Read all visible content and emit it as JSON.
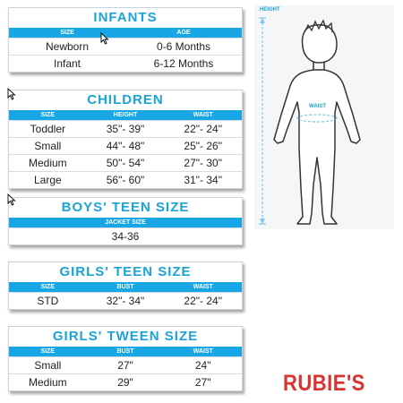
{
  "infants": {
    "title": "INFANTS",
    "headers": [
      "SIZE",
      "AGE"
    ],
    "rows": [
      [
        "Newborn",
        "0-6 Months"
      ],
      [
        "Infant",
        "6-12 Months"
      ]
    ]
  },
  "children": {
    "title": "CHILDREN",
    "headers": [
      "SIZE",
      "HEIGHT",
      "WAIST"
    ],
    "rows": [
      [
        "Toddler",
        "35\"- 39\"",
        "22\"- 24\""
      ],
      [
        "Small",
        "44\"- 48\"",
        "25\"- 26\""
      ],
      [
        "Medium",
        "50\"- 54\"",
        "27\"- 30\""
      ],
      [
        "Large",
        "56\"- 60\"",
        "31\"- 34\""
      ]
    ]
  },
  "boys_teen": {
    "title": "BOYS' TEEN SIZE",
    "headers": [
      "JACKET SIZE"
    ],
    "rows": [
      [
        "34-36"
      ]
    ]
  },
  "girls_teen": {
    "title": "GIRLS' TEEN SIZE",
    "headers": [
      "SIZE",
      "BUST",
      "WAIST"
    ],
    "rows": [
      [
        "STD",
        "32\"- 34\"",
        "22\"- 24\""
      ]
    ]
  },
  "girls_tween": {
    "title": "GIRLS' TWEEN SIZE",
    "headers": [
      "SIZE",
      "BUST",
      "WAIST"
    ],
    "rows": [
      [
        "Small",
        "27\"",
        "24\""
      ],
      [
        "Medium",
        "29\"",
        "27\""
      ]
    ]
  },
  "figure": {
    "height_label": "HEIGHT",
    "waist_label": "WAIST"
  },
  "brand": "RUBIE'S",
  "colors": {
    "accent": "#1aa3d6",
    "header_bar": "#18a7e4",
    "brand": "#d8342f"
  }
}
